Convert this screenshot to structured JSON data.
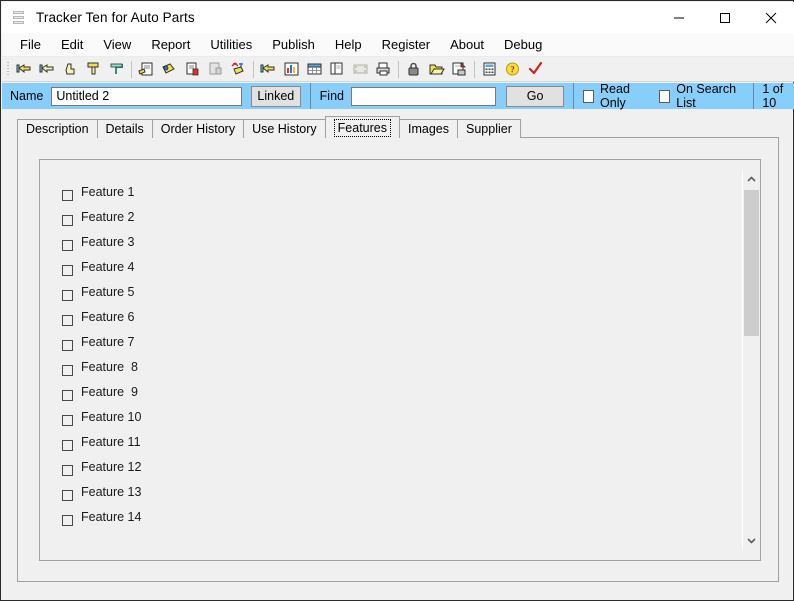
{
  "window": {
    "title": "Tracker Ten for Auto Parts",
    "icon": "database-stack-icon",
    "controls": {
      "minimize": "minimize-icon",
      "maximize": "maximize-icon",
      "close": "close-icon"
    }
  },
  "menubar": {
    "items": [
      {
        "label": "File"
      },
      {
        "label": "Edit"
      },
      {
        "label": "View"
      },
      {
        "label": "Report"
      },
      {
        "label": "Utilities"
      },
      {
        "label": "Publish"
      },
      {
        "label": "Help"
      },
      {
        "label": "Register"
      },
      {
        "label": "About"
      },
      {
        "label": "Debug"
      }
    ]
  },
  "toolbar": {
    "groups": [
      {
        "buttons": [
          {
            "icon": "hand-first-record-icon"
          },
          {
            "icon": "hand-previous-record-icon"
          },
          {
            "icon": "hand-stop-icon"
          },
          {
            "icon": "hand-next-record-icon"
          },
          {
            "icon": "hand-last-record-icon"
          }
        ]
      },
      {
        "buttons": [
          {
            "icon": "edit-record-icon"
          },
          {
            "icon": "new-record-icon"
          },
          {
            "icon": "delete-record-icon"
          },
          {
            "icon": "copy-record-icon"
          },
          {
            "icon": "spelling-check-icon"
          }
        ]
      },
      {
        "buttons": [
          {
            "icon": "pointer-hand-icon"
          },
          {
            "icon": "chart-report-icon"
          },
          {
            "icon": "grid-table-icon"
          },
          {
            "icon": "duplicate-pages-icon"
          },
          {
            "icon": "filmstrip-icon"
          },
          {
            "icon": "print-icon"
          }
        ]
      },
      {
        "buttons": [
          {
            "icon": "lock-icon"
          },
          {
            "icon": "open-folder-icon"
          },
          {
            "icon": "save-as-icon"
          }
        ]
      },
      {
        "buttons": [
          {
            "icon": "calculator-icon"
          },
          {
            "icon": "help-question-icon"
          },
          {
            "icon": "checkmark-icon"
          }
        ]
      }
    ]
  },
  "namebar": {
    "name_label": "Name",
    "name_value": "Untitled 2",
    "name_placeholder": "",
    "linked_label": "Linked",
    "find_label": "Find",
    "find_value": "",
    "find_placeholder": "",
    "go_label": "Go",
    "read_only_label": "Read Only",
    "read_only_checked": false,
    "on_search_list_label": "On Search List",
    "on_search_list_checked": false,
    "record_count": "1 of 10"
  },
  "tabs": {
    "selected": "Features",
    "items": [
      {
        "label": "Description"
      },
      {
        "label": "Details"
      },
      {
        "label": "Order History"
      },
      {
        "label": "Use History"
      },
      {
        "label": "Features"
      },
      {
        "label": "Images"
      },
      {
        "label": "Supplier"
      }
    ]
  },
  "features": {
    "items": [
      {
        "label": "Feature 1",
        "checked": false
      },
      {
        "label": "Feature 2",
        "checked": false
      },
      {
        "label": "Feature 3",
        "checked": false
      },
      {
        "label": "Feature 4",
        "checked": false
      },
      {
        "label": "Feature 5",
        "checked": false
      },
      {
        "label": "Feature 6",
        "checked": false
      },
      {
        "label": "Feature 7",
        "checked": false
      },
      {
        "label": "Feature  8",
        "checked": false
      },
      {
        "label": "Feature  9",
        "checked": false
      },
      {
        "label": "Feature 10",
        "checked": false
      },
      {
        "label": "Feature 11",
        "checked": false
      },
      {
        "label": "Feature 12",
        "checked": false
      },
      {
        "label": "Feature 13",
        "checked": false
      },
      {
        "label": "Feature 14",
        "checked": false
      }
    ]
  },
  "scrollbar": {
    "up_arrow": "chevron-up-icon",
    "down_arrow": "chevron-down-icon",
    "thumb": "scroll-thumb"
  },
  "colors": {
    "namebar_blue": "#87cefa",
    "window_bg": "#f0f0f0",
    "border": "#a0a0a0"
  }
}
